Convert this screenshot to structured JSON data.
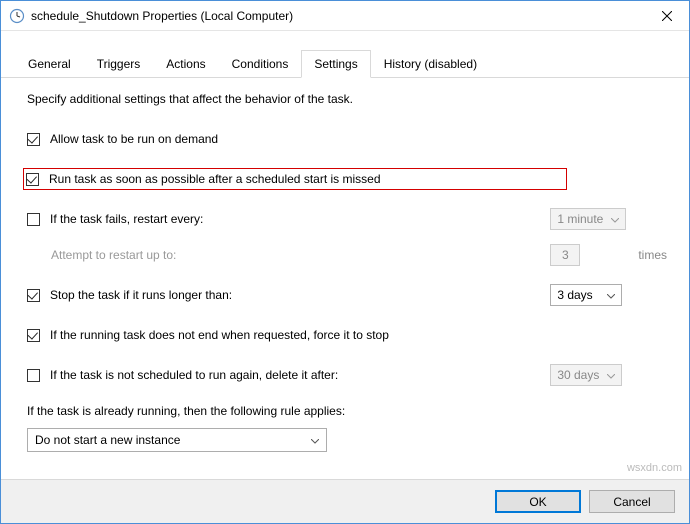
{
  "title": "schedule_Shutdown Properties (Local Computer)",
  "tabs": {
    "general": "General",
    "triggers": "Triggers",
    "actions": "Actions",
    "conditions": "Conditions",
    "settings": "Settings",
    "history": "History (disabled)"
  },
  "intro": "Specify additional settings that affect the behavior of the task.",
  "opts": {
    "allow_on_demand": "Allow task to be run on demand",
    "run_missed": "Run task as soon as possible after a scheduled start is missed",
    "restart_if_fail": "If the task fails, restart every:",
    "restart_combo": "1 minute",
    "attempt_label": "Attempt to restart up to:",
    "attempt_value": "3",
    "attempt_suffix": "times",
    "stop_longer": "Stop the task if it runs longer than:",
    "stop_longer_combo": "3 days",
    "force_stop": "If the running task does not end when requested, force it to stop",
    "delete_after": "If the task is not scheduled to run again, delete it after:",
    "delete_after_combo": "30 days",
    "rule_label": "If the task is already running, then the following rule applies:",
    "rule_combo": "Do not start a new instance"
  },
  "buttons": {
    "ok": "OK",
    "cancel": "Cancel"
  },
  "watermark": "wsxdn.com"
}
